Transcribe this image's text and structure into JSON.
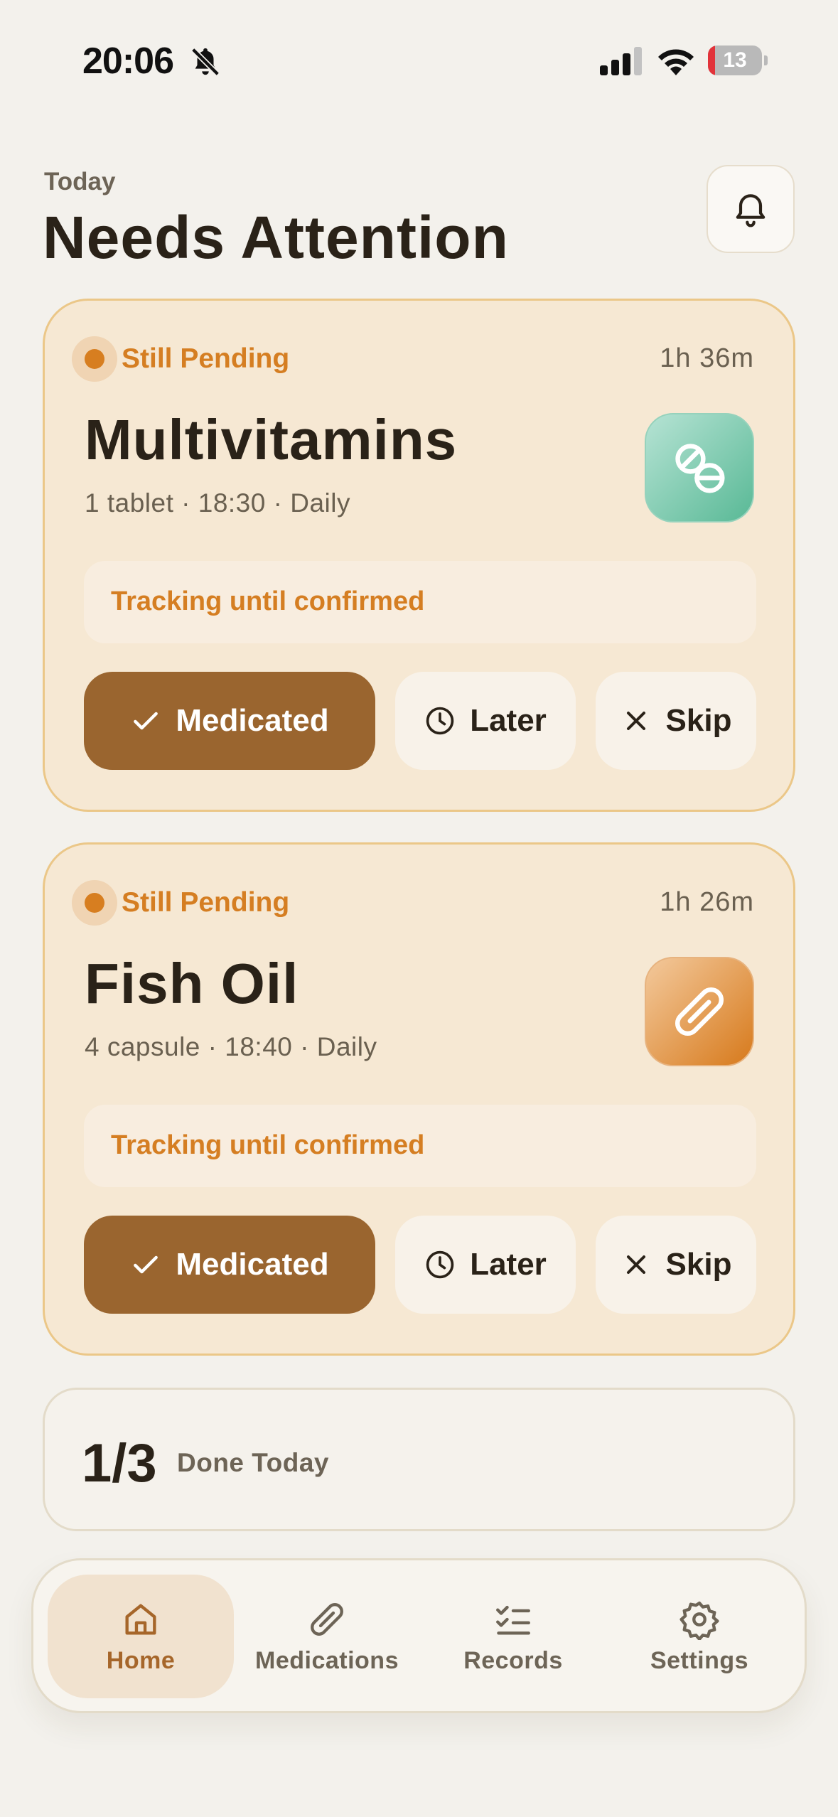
{
  "status_bar": {
    "time": "20:06",
    "battery": "13",
    "battery_level": 0.13
  },
  "header": {
    "subtitle": "Today",
    "title": "Needs Attention"
  },
  "cards": [
    {
      "status": "Still Pending",
      "countdown": "1h 36m",
      "name": "Multivitamins",
      "detail": "1 tablet · 18:30 · Daily",
      "icon": "tablets-icon",
      "icon_color": "#59b996",
      "tracking": "Tracking until confirmed",
      "actions": {
        "medicated": "Medicated",
        "later": "Later",
        "skip": "Skip"
      }
    },
    {
      "status": "Still Pending",
      "countdown": "1h 26m",
      "name": "Fish Oil",
      "detail": "4 capsule · 18:40 · Daily",
      "icon": "capsule-icon",
      "icon_color": "#d77a1c",
      "tracking": "Tracking until confirmed",
      "actions": {
        "medicated": "Medicated",
        "later": "Later",
        "skip": "Skip"
      }
    }
  ],
  "summary": {
    "count": "1/3",
    "label": "Done Today"
  },
  "tabs": [
    {
      "label": "Home",
      "icon": "home-icon",
      "active": true
    },
    {
      "label": "Medications",
      "icon": "capsule-icon",
      "active": false
    },
    {
      "label": "Records",
      "icon": "checklist-icon",
      "active": false
    },
    {
      "label": "Settings",
      "icon": "gear-icon",
      "active": false
    }
  ],
  "colors": {
    "background": "#f3f1ec",
    "card": "#f6e8d3",
    "card_border": "#ebc788",
    "accent": "#d57e22",
    "primary_button": "#9a652f",
    "battery_low": "#e2333a"
  }
}
